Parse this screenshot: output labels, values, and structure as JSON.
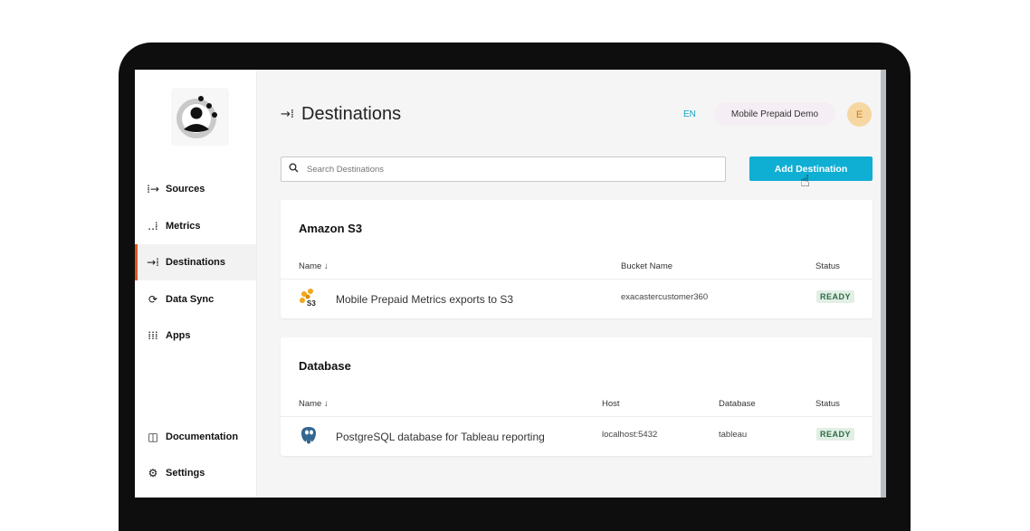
{
  "sidebar": {
    "items": [
      {
        "label": "Sources",
        "icon": "sources-icon",
        "glyph": "⁞→"
      },
      {
        "label": "Metrics",
        "icon": "metrics-icon",
        "glyph": "..⁞"
      },
      {
        "label": "Destinations",
        "icon": "destinations-icon",
        "glyph": "→⁞"
      },
      {
        "label": "Data Sync",
        "icon": "sync-icon",
        "glyph": "⟳"
      },
      {
        "label": "Apps",
        "icon": "apps-grid-icon",
        "glyph": "⁞⁞⁞"
      }
    ],
    "active": "Destinations",
    "bottom": [
      {
        "label": "Documentation",
        "icon": "book-icon",
        "glyph": "◫"
      },
      {
        "label": "Settings",
        "icon": "gear-icon",
        "glyph": "⚙"
      }
    ]
  },
  "header": {
    "title": "Destinations",
    "title_glyph": "→⁞",
    "language": "EN",
    "workspace": "Mobile Prepaid Demo",
    "avatar_initial": "E"
  },
  "toolbar": {
    "search_placeholder": "Search Destinations",
    "add_label": "Add Destination"
  },
  "groups": {
    "s3": {
      "title": "Amazon S3",
      "columns": [
        "Name ↓",
        "Bucket Name",
        "Status"
      ],
      "rows": [
        {
          "name": "Mobile Prepaid Metrics exports to S3",
          "bucket": "exacastercustomer360",
          "status": "READY",
          "icon": "amazon-s3-icon"
        }
      ]
    },
    "db": {
      "title": "Database",
      "columns": [
        "Name ↓",
        "Host",
        "Database",
        "Status"
      ],
      "rows": [
        {
          "name": "PostgreSQL database for Tableau reporting",
          "host": "localhost:5432",
          "database": "tableau",
          "status": "READY",
          "icon": "postgresql-icon"
        }
      ]
    }
  },
  "colors": {
    "accent": "#0faed3",
    "active_marker": "#e3541f",
    "ready_bg": "#e1efe5",
    "ready_text": "#2f6b44"
  }
}
